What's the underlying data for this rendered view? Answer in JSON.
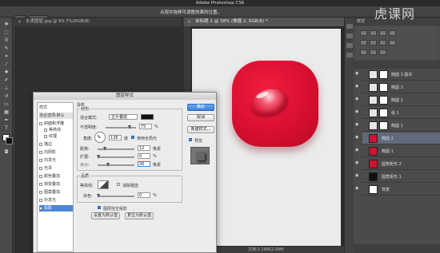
{
  "app": {
    "title": "Adobe Photoshop CS6",
    "hint": "点按并拖移可调整效果的位置。",
    "watermark": "虎课网"
  },
  "tabs": [
    {
      "label": "水滴图层.jpg @ 83.7%(RGB/8)"
    },
    {
      "label": "未标题-1 @ 38% (椭圆 2, RGB/8) *"
    }
  ],
  "status": {
    "doc": "文档:3.16M/2.09M"
  },
  "right_panel": {
    "tab_label": "样式"
  },
  "layers": [
    {
      "name": "椭圆 3 副本",
      "thumb": "#e5e5e5",
      "mask": true
    },
    {
      "name": "椭圆 3",
      "thumb": "#e5e5e5",
      "mask": true
    },
    {
      "name": "椭圆 2",
      "thumb": "#e5e5e5",
      "mask": true
    },
    {
      "name": "组 1",
      "thumb": "#e5e5e5",
      "mask": true
    },
    {
      "name": "椭圆 1",
      "thumb": "#e5e5e5",
      "mask": true
    },
    {
      "name": "椭圆 2",
      "thumb": "#d0142f",
      "mask": false,
      "selected": true
    },
    {
      "name": "椭圆 1",
      "thumb": "#d0142f",
      "mask": false
    },
    {
      "name": "圆角矩形 2",
      "thumb": "#d0142f",
      "mask": false
    },
    {
      "name": "圆角矩形 1",
      "thumb": "#111111",
      "mask": false
    },
    {
      "name": "背景",
      "thumb": "#ffffff",
      "mask": false
    }
  ],
  "dialog": {
    "title": "图层样式",
    "styles_header": "样式",
    "blend_options": "混合选项:默认",
    "style_items": [
      "斜面和浮雕",
      "等高线",
      "纹理",
      "描边",
      "内阴影",
      "内发光",
      "光泽",
      "颜色叠加",
      "渐变叠加",
      "图案叠加",
      "外发光",
      "投影"
    ],
    "section_title": "投影",
    "structure_title": "结构",
    "blend_mode_label": "混合模式:",
    "blend_mode_value": "正片叠底",
    "opacity_label": "不透明度:",
    "opacity_value": "75",
    "angle_label": "角度:",
    "angle_value": "136",
    "angle_unit": "度",
    "global_light_label": "使用全局光",
    "distance_label": "距离:",
    "distance_value": "12",
    "spread_label": "扩展:",
    "spread_value": "0",
    "size_label": "大小:",
    "size_value": "26",
    "unit_px": "像素",
    "unit_pct": "%",
    "quality_title": "品质",
    "contour_label": "等高线:",
    "antialias_label": "消除锯齿",
    "noise_label": "杂色:",
    "noise_value": "0",
    "knockout_label": "图层挖空投影",
    "make_default": "设置为默认值",
    "reset_default": "复位为默认值",
    "ok": "确定",
    "cancel": "取消",
    "new_style": "新建样式...",
    "preview": "预览",
    "swatch_color": "#111111",
    "shadow_color": "#111111"
  }
}
